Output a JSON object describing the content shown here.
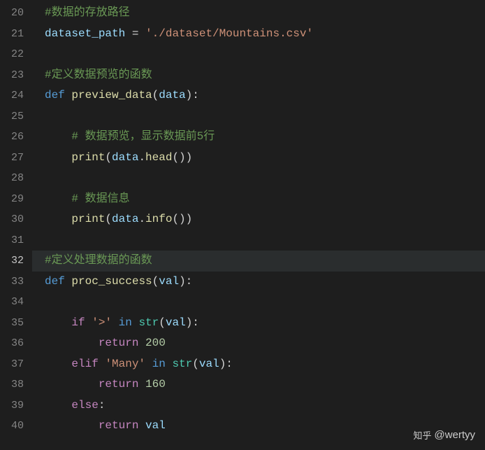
{
  "gutter": {
    "start": 20,
    "end": 40,
    "active": 32
  },
  "lines": {
    "l20": {
      "comment": "#数据的存放路径"
    },
    "l21": {
      "var": "dataset_path",
      "op": " = ",
      "str": "'./dataset/Mountains.csv'"
    },
    "l22": {},
    "l23": {
      "comment": "#定义数据预览的函数"
    },
    "l24": {
      "kw": "def",
      "fn": "preview_data",
      "p1": "(",
      "arg": "data",
      "p2": "):"
    },
    "l25": {},
    "l26": {
      "comment": "# 数据预览，显示数据前5行"
    },
    "l27": {
      "fn": "print",
      "p1": "(",
      "var": "data",
      "p2": ".",
      "method": "head",
      "p3": "())"
    },
    "l28": {},
    "l29": {
      "comment": "# 数据信息"
    },
    "l30": {
      "fn": "print",
      "p1": "(",
      "var": "data",
      "p2": ".",
      "method": "info",
      "p3": "())"
    },
    "l31": {},
    "l32": {
      "comment": "#定义处理数据的函数"
    },
    "l33": {
      "kw": "def",
      "fn": "proc_success",
      "p1": "(",
      "arg": "val",
      "p2": "):"
    },
    "l34": {},
    "l35": {
      "kw": "if",
      "str": "'>'",
      "op": "in",
      "fn": "str",
      "p1": "(",
      "var": "val",
      "p2": "):"
    },
    "l36": {
      "kw": "return",
      "num": "200"
    },
    "l37": {
      "kw": "elif",
      "str": "'Many'",
      "op": "in",
      "fn": "str",
      "p1": "(",
      "var": "val",
      "p2": "):"
    },
    "l38": {
      "kw": "return",
      "num": "160"
    },
    "l39": {
      "kw": "else",
      "p": ":"
    },
    "l40": {
      "kw": "return",
      "var": "val"
    }
  },
  "watermark": {
    "brand": "知乎",
    "handle": "@wertyy"
  }
}
